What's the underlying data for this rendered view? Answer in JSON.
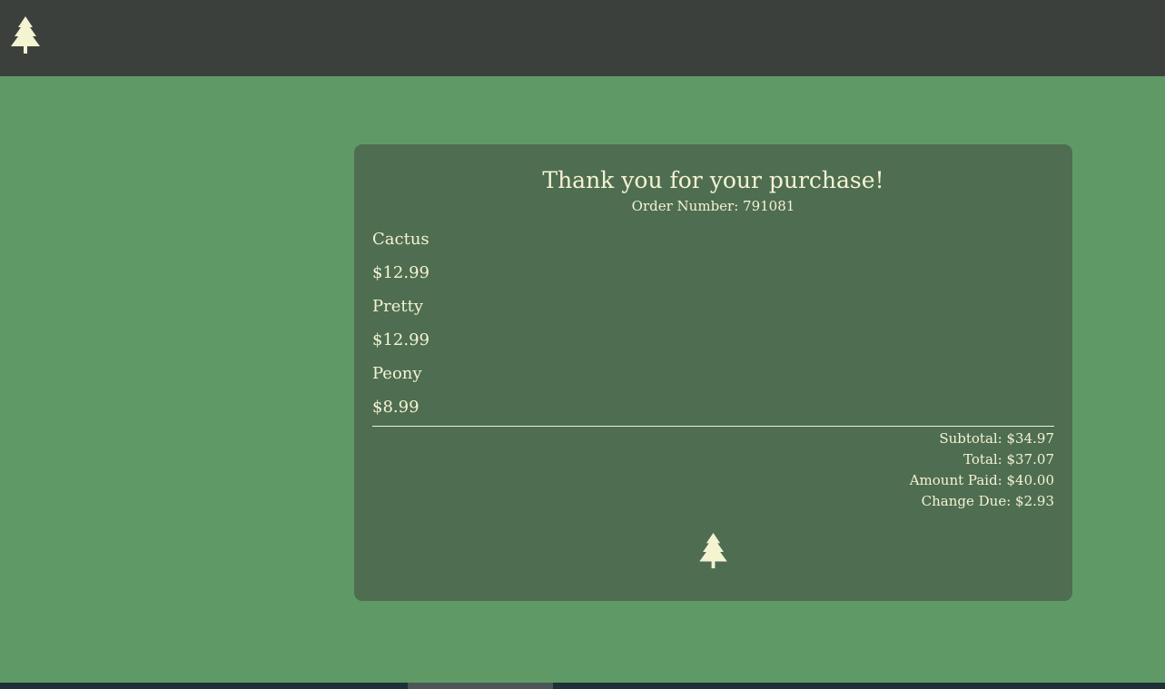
{
  "header": {
    "logo_icon": "pine-tree-icon"
  },
  "receipt": {
    "title": "Thank you for your purchase!",
    "order_number": "Order Number: 791081",
    "items": [
      {
        "name": "Cactus",
        "price": "$12.99"
      },
      {
        "name": "Pretty",
        "price": "$12.99"
      },
      {
        "name": "Peony",
        "price": "$8.99"
      }
    ],
    "subtotal": "Subtotal: $34.97",
    "total": "Total: $37.07",
    "amount_paid": "Amount Paid: $40.00",
    "change_due": "Change Due: $2.93",
    "footer_icon": "pine-tree-icon"
  },
  "colors": {
    "page_background": "#5f9a66",
    "header_background": "#3c403d",
    "card_background": "#4e6d51",
    "text": "#f4f3d2",
    "scrollbar_track": "#1f3038",
    "scrollbar_thumb": "#4c5659"
  }
}
